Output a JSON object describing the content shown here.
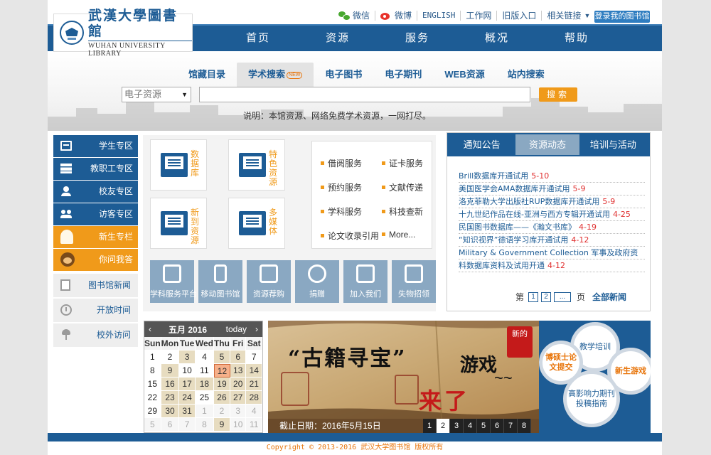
{
  "toplinks": {
    "wechat": "微信",
    "weibo": "微博",
    "english": "ENGLISH",
    "worknet": "工作网",
    "old_portal": "旧版入口",
    "related": "相关链接",
    "login": "登录我的图书馆"
  },
  "logo": {
    "cn": "武漢大學圖書館",
    "en": "WUHAN UNIVERSITY LIBRARY"
  },
  "nav": [
    "首页",
    "资源",
    "服务",
    "概况",
    "帮助"
  ],
  "search": {
    "tabs": [
      "馆藏目录",
      "学术搜索",
      "电子图书",
      "电子期刊",
      "WEB资源",
      "站内搜索"
    ],
    "new_badge": "NEW",
    "select_value": "电子资源",
    "button": "搜索",
    "note": "说明：本馆资源、网络免费学术资源，一网打尽。"
  },
  "sidebar": [
    {
      "label": "学生专区"
    },
    {
      "label": "教职工专区"
    },
    {
      "label": "校友专区"
    },
    {
      "label": "访客专区"
    },
    {
      "label": "新生专栏"
    },
    {
      "label": "你问我答"
    },
    {
      "label": "图书馆新闻"
    },
    {
      "label": "开放时间"
    },
    {
      "label": "校外访问"
    }
  ],
  "tiles": [
    "数据库",
    "特色资源",
    "新到资源",
    "多媒体"
  ],
  "service_links": [
    "借阅服务",
    "证卡服务",
    "预约服务",
    "文献传递",
    "学科服务",
    "科技查新",
    "论文收录引用",
    "More..."
  ],
  "quick_buttons": [
    "学科服务平台",
    "移动图书馆",
    "资源荐购",
    "捐赠",
    "加入我们",
    "失物招领"
  ],
  "news": {
    "tabs": [
      "通知公告",
      "资源动态",
      "培训与活动"
    ],
    "items": [
      {
        "title": "Brill数据库开通试用",
        "date": "5-10"
      },
      {
        "title": "美国医学会AMA数据库开通试用",
        "date": "5-9"
      },
      {
        "title": "洛克菲勒大学出版社RUP数据库开通试用",
        "date": "5-9"
      },
      {
        "title": "十九世纪作品在线-亚洲与西方专辑开通试用",
        "date": "4-25"
      },
      {
        "title": "民国图书数据库——《瀚文书库》",
        "date": "4-19"
      },
      {
        "title": "“知识视界”德语学习库开通试用",
        "date": "4-12"
      },
      {
        "title": "Military & Government Collection 军事及政府资",
        "date": ""
      },
      {
        "title": "料数据库资料及试用开通",
        "date": "4-12"
      }
    ],
    "pager_label": "第",
    "pages": [
      "1",
      "2",
      "..."
    ],
    "page_suffix": "页",
    "all": "全部新闻"
  },
  "calendar": {
    "month": "五月 2016",
    "today": "today",
    "prev": "‹",
    "next": "›",
    "weekdays": [
      "Sun",
      "Mon",
      "Tue",
      "Wed",
      "Thu",
      "Fri",
      "Sat"
    ],
    "days": [
      {
        "d": "1",
        "s": "cur"
      },
      {
        "d": "2",
        "s": "cur"
      },
      {
        "d": "3",
        "s": "ev"
      },
      {
        "d": "4",
        "s": "cur"
      },
      {
        "d": "5",
        "s": "ev"
      },
      {
        "d": "6",
        "s": "ev"
      },
      {
        "d": "7",
        "s": "cur"
      },
      {
        "d": "8",
        "s": "cur"
      },
      {
        "d": "9",
        "s": "ev"
      },
      {
        "d": "10",
        "s": "cur"
      },
      {
        "d": "11",
        "s": "cur"
      },
      {
        "d": "12",
        "s": "today"
      },
      {
        "d": "13",
        "s": "ev"
      },
      {
        "d": "14",
        "s": "ev"
      },
      {
        "d": "15",
        "s": "cur"
      },
      {
        "d": "16",
        "s": "ev"
      },
      {
        "d": "17",
        "s": "ev"
      },
      {
        "d": "18",
        "s": "ev"
      },
      {
        "d": "19",
        "s": "ev"
      },
      {
        "d": "20",
        "s": "ev"
      },
      {
        "d": "21",
        "s": "ev"
      },
      {
        "d": "22",
        "s": "cur"
      },
      {
        "d": "23",
        "s": "ev"
      },
      {
        "d": "24",
        "s": "ev"
      },
      {
        "d": "25",
        "s": "cur"
      },
      {
        "d": "26",
        "s": "ev"
      },
      {
        "d": "27",
        "s": "ev"
      },
      {
        "d": "28",
        "s": "ev"
      },
      {
        "d": "29",
        "s": "cur"
      },
      {
        "d": "30",
        "s": "ev"
      },
      {
        "d": "31",
        "s": "ev"
      },
      {
        "d": "1",
        "s": "other"
      },
      {
        "d": "2",
        "s": "other"
      },
      {
        "d": "3",
        "s": "other"
      },
      {
        "d": "4",
        "s": "other"
      },
      {
        "d": "5",
        "s": "other"
      },
      {
        "d": "6",
        "s": "other"
      },
      {
        "d": "7",
        "s": "other"
      },
      {
        "d": "8",
        "s": "other"
      },
      {
        "d": "9",
        "s": "ev"
      },
      {
        "d": "10",
        "s": "other"
      },
      {
        "d": "11",
        "s": "other"
      }
    ]
  },
  "banner": {
    "main": "“古籍寻宝”",
    "sub": "游戏",
    "red": "来了",
    "tilde": "~~",
    "stamp": "新的",
    "deadline": "截止日期：2016年5月15日",
    "pages": [
      "1",
      "2",
      "3",
      "4",
      "5",
      "6",
      "7",
      "8"
    ]
  },
  "promo": [
    "教学培训",
    "博硕士论文提交",
    "新生游戏",
    "高影响力期刊投稿指南"
  ],
  "footer": "Copyright © 2013-2016 武汉大学图书馆 版权所有",
  "colors": {
    "brand": "#1d5c95",
    "accent": "#f09a1a",
    "date": "#e03030"
  }
}
